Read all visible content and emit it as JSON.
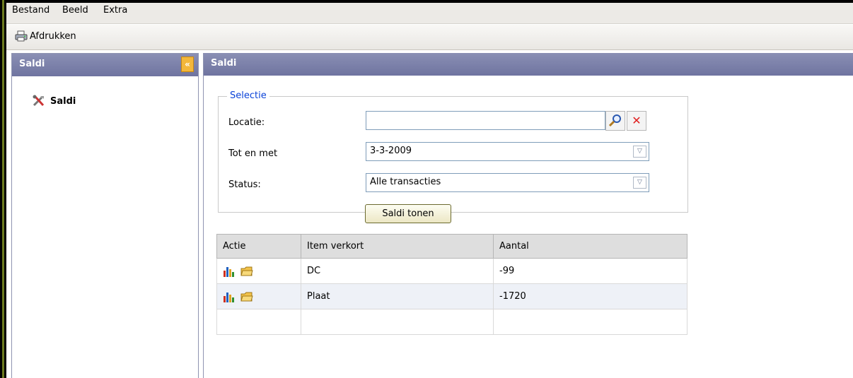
{
  "menubar": {
    "items": [
      "Bestand",
      "Beeld",
      "Extra"
    ]
  },
  "toolbar": {
    "print_label": "Afdrukken",
    "print_icon": "printer-icon"
  },
  "left_panel": {
    "title": "Saldi",
    "collapse_glyph": "«",
    "nav_item_label": "Saldi",
    "nav_item_icon": "tools-icon"
  },
  "main": {
    "title": "Saldi",
    "selection": {
      "legend": "Selectie",
      "location_label": "Locatie:",
      "location_value": "",
      "until_label": "Tot en met",
      "until_value": "3-3-2009",
      "status_label": "Status:",
      "status_value": "Alle transacties",
      "show_button": "Saldi tonen"
    },
    "grid": {
      "columns": [
        "Actie",
        "Item verkort",
        "Aantal"
      ],
      "rows": [
        {
          "item": "DC",
          "amount": "-99"
        },
        {
          "item": "Plaat",
          "amount": "-1720"
        }
      ]
    }
  },
  "colors": {
    "panel_header": "#7a7fa8",
    "legend": "#0a42d8",
    "collapse_button": "#f3b73b"
  }
}
